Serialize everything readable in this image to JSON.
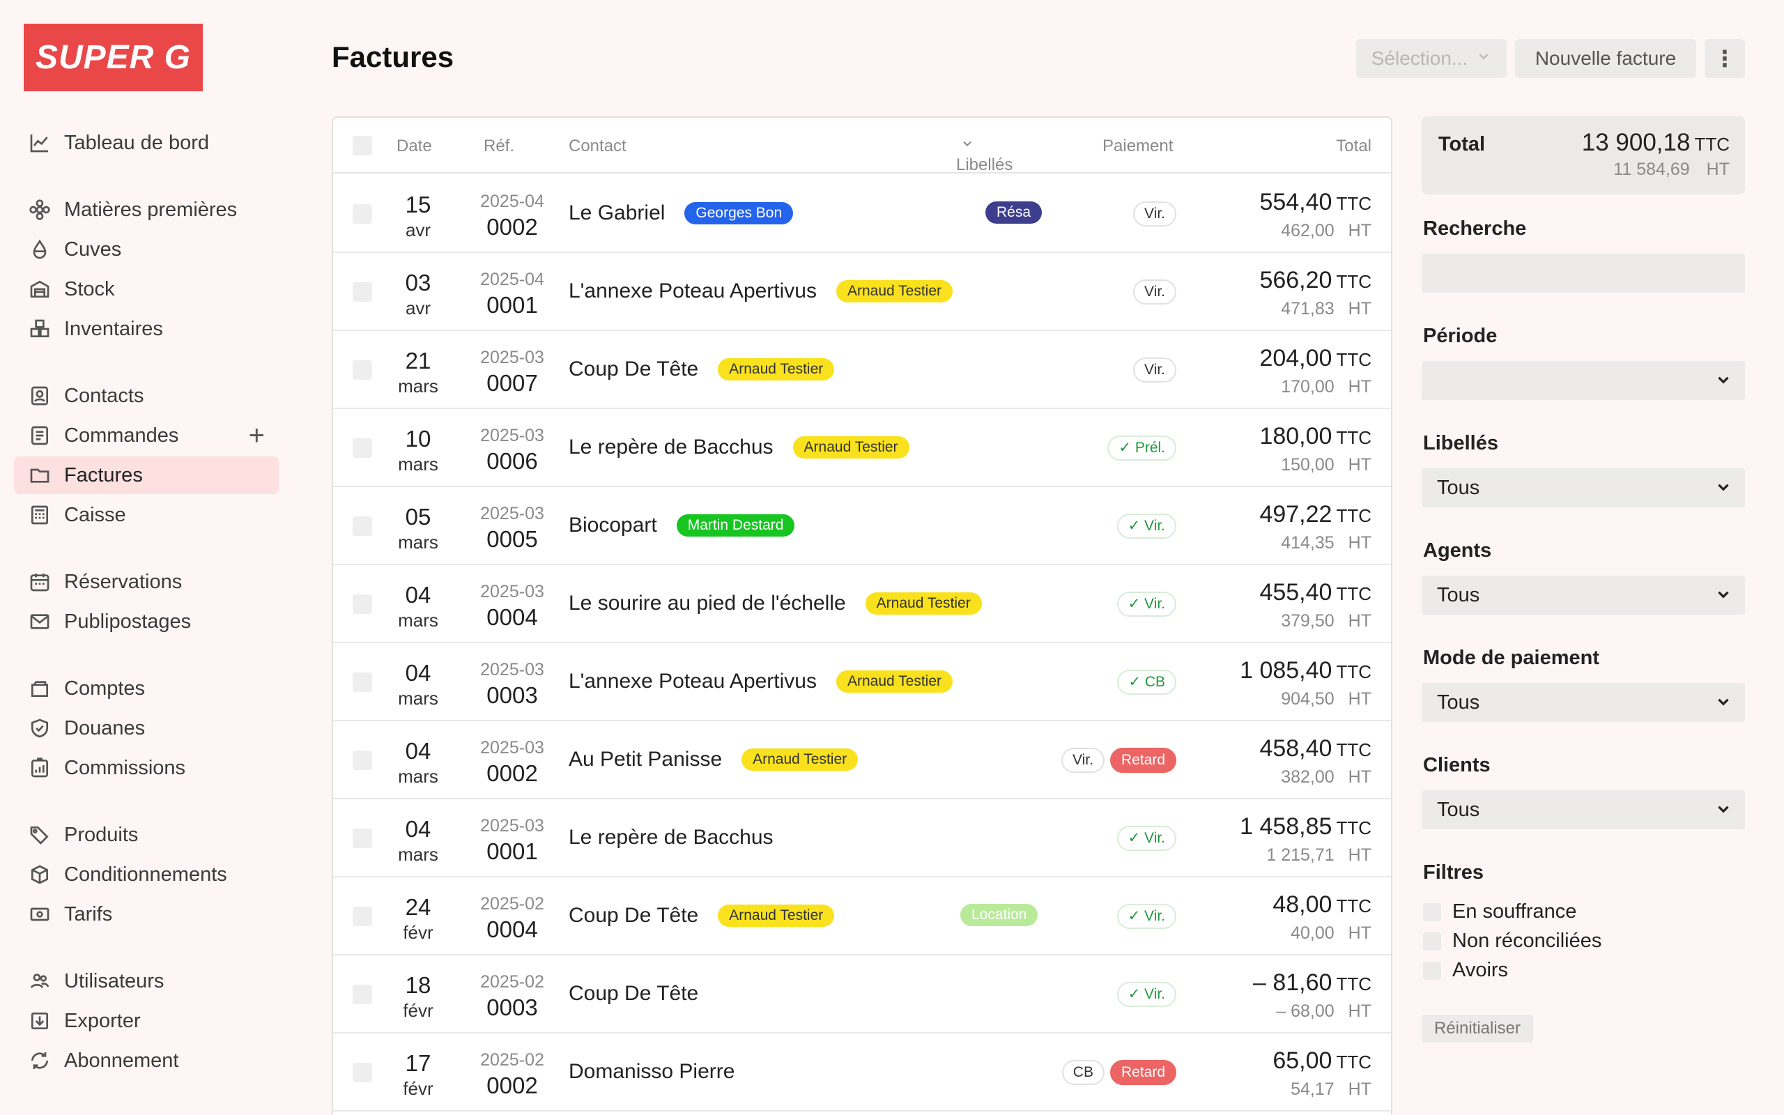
{
  "brand": {
    "logo_text": "SUPER G",
    "accent": "#ea4848"
  },
  "sidebar": {
    "items": [
      {
        "label": "Tableau de bord",
        "icon": "chart-line-icon"
      },
      {
        "label": "Matières premières",
        "icon": "flower-icon"
      },
      {
        "label": "Cuves",
        "icon": "droplet-icon"
      },
      {
        "label": "Stock",
        "icon": "warehouse-icon"
      },
      {
        "label": "Inventaires",
        "icon": "boxes-icon"
      },
      {
        "label": "Contacts",
        "icon": "contact-card-icon"
      },
      {
        "label": "Commandes",
        "icon": "order-list-icon"
      },
      {
        "label": "Factures",
        "icon": "folder-icon",
        "active": true
      },
      {
        "label": "Caisse",
        "icon": "register-icon"
      },
      {
        "label": "Réservations",
        "icon": "calendar-icon"
      },
      {
        "label": "Publipostages",
        "icon": "mail-icon"
      },
      {
        "label": "Comptes",
        "icon": "wallet-icon"
      },
      {
        "label": "Douanes",
        "icon": "shield-check-icon"
      },
      {
        "label": "Commissions",
        "icon": "commission-icon"
      },
      {
        "label": "Produits",
        "icon": "tags-icon"
      },
      {
        "label": "Conditionnements",
        "icon": "package-icon"
      },
      {
        "label": "Tarifs",
        "icon": "banknote-icon"
      },
      {
        "label": "Utilisateurs",
        "icon": "users-icon"
      },
      {
        "label": "Exporter",
        "icon": "export-icon"
      },
      {
        "label": "Abonnement",
        "icon": "refresh-icon"
      }
    ],
    "commandes_add": "+"
  },
  "header": {
    "title": "Factures",
    "selection_label": "Sélection...",
    "new_invoice_label": "Nouvelle facture",
    "more_label": "⋮"
  },
  "table": {
    "columns": {
      "date": "Date",
      "ref": "Réf.",
      "contact": "Contact",
      "labels": "Libellés",
      "payment": "Paiement",
      "total": "Total"
    },
    "ttc_unit": "TTC",
    "ht_unit": "HT",
    "rows": [
      {
        "day": "15",
        "month": "avr",
        "ref_year": "2025-04",
        "ref_num": "0002",
        "contact": "Le Gabriel",
        "agent": "Georges Bon",
        "agent_color": "blue",
        "label": "Résa",
        "label_style": "resa",
        "payment": [
          {
            "text": "Vir.",
            "style": "plain"
          }
        ],
        "ttc": "554,40",
        "ht": "462,00"
      },
      {
        "day": "03",
        "month": "avr",
        "ref_year": "2025-04",
        "ref_num": "0001",
        "contact": "L'annexe Poteau Apertivus",
        "agent": "Arnaud Testier",
        "agent_color": "yellow",
        "label": "",
        "label_style": "",
        "payment": [
          {
            "text": "Vir.",
            "style": "plain"
          }
        ],
        "ttc": "566,20",
        "ht": "471,83"
      },
      {
        "day": "21",
        "month": "mars",
        "ref_year": "2025-03",
        "ref_num": "0007",
        "contact": "Coup De Tête",
        "agent": "Arnaud Testier",
        "agent_color": "yellow",
        "label": "",
        "label_style": "",
        "payment": [
          {
            "text": "Vir.",
            "style": "plain"
          }
        ],
        "ttc": "204,00",
        "ht": "170,00"
      },
      {
        "day": "10",
        "month": "mars",
        "ref_year": "2025-03",
        "ref_num": "0006",
        "contact": "Le repère de Bacchus",
        "agent": "Arnaud Testier",
        "agent_color": "yellow",
        "label": "",
        "label_style": "",
        "payment": [
          {
            "text": "✓ Prél.",
            "style": "ok"
          }
        ],
        "ttc": "180,00",
        "ht": "150,00"
      },
      {
        "day": "05",
        "month": "mars",
        "ref_year": "2025-03",
        "ref_num": "0005",
        "contact": "Biocopart",
        "agent": "Martin Destard",
        "agent_color": "green",
        "label": "",
        "label_style": "",
        "payment": [
          {
            "text": "✓ Vir.",
            "style": "ok"
          }
        ],
        "ttc": "497,22",
        "ht": "414,35"
      },
      {
        "day": "04",
        "month": "mars",
        "ref_year": "2025-03",
        "ref_num": "0004",
        "contact": "Le sourire au pied de l'échelle",
        "agent": "Arnaud Testier",
        "agent_color": "yellow",
        "label": "",
        "label_style": "",
        "payment": [
          {
            "text": "✓ Vir.",
            "style": "ok"
          }
        ],
        "ttc": "455,40",
        "ht": "379,50"
      },
      {
        "day": "04",
        "month": "mars",
        "ref_year": "2025-03",
        "ref_num": "0003",
        "contact": "L'annexe Poteau Apertivus",
        "agent": "Arnaud Testier",
        "agent_color": "yellow",
        "label": "",
        "label_style": "",
        "payment": [
          {
            "text": "✓ CB",
            "style": "ok"
          }
        ],
        "ttc": "1 085,40",
        "ht": "904,50"
      },
      {
        "day": "04",
        "month": "mars",
        "ref_year": "2025-03",
        "ref_num": "0002",
        "contact": "Au Petit Panisse",
        "agent": "Arnaud Testier",
        "agent_color": "yellow",
        "label": "",
        "label_style": "",
        "payment": [
          {
            "text": "Vir.",
            "style": "plain"
          },
          {
            "text": "Retard",
            "style": "late"
          }
        ],
        "ttc": "458,40",
        "ht": "382,00"
      },
      {
        "day": "04",
        "month": "mars",
        "ref_year": "2025-03",
        "ref_num": "0001",
        "contact": "Le repère de Bacchus",
        "agent": "",
        "agent_color": "",
        "label": "",
        "label_style": "",
        "payment": [
          {
            "text": "✓ Vir.",
            "style": "ok"
          }
        ],
        "ttc": "1 458,85",
        "ht": "1 215,71"
      },
      {
        "day": "24",
        "month": "févr",
        "ref_year": "2025-02",
        "ref_num": "0004",
        "contact": "Coup De Tête",
        "agent": "Arnaud Testier",
        "agent_color": "yellow",
        "label": "Location",
        "label_style": "loc",
        "payment": [
          {
            "text": "✓ Vir.",
            "style": "ok"
          }
        ],
        "ttc": "48,00",
        "ht": "40,00"
      },
      {
        "day": "18",
        "month": "févr",
        "ref_year": "2025-02",
        "ref_num": "0003",
        "contact": "Coup De Tête",
        "agent": "",
        "agent_color": "",
        "label": "",
        "label_style": "",
        "payment": [
          {
            "text": "✓ Vir.",
            "style": "ok"
          }
        ],
        "ttc": "– 81,60",
        "ht": "– 68,00"
      },
      {
        "day": "17",
        "month": "févr",
        "ref_year": "2025-02",
        "ref_num": "0002",
        "contact": "Domanisso Pierre",
        "agent": "",
        "agent_color": "",
        "label": "",
        "label_style": "",
        "payment": [
          {
            "text": "CB",
            "style": "plain"
          },
          {
            "text": "Retard",
            "style": "late"
          }
        ],
        "ttc": "65,00",
        "ht": "54,17"
      }
    ]
  },
  "panel": {
    "total_label": "Total",
    "total_ttc": "13 900,18",
    "total_ht": "11 584,69",
    "search_label": "Recherche",
    "search_value": "",
    "period_label": "Période",
    "period_value": "",
    "labels_label": "Libellés",
    "labels_value": "Tous",
    "agents_label": "Agents",
    "agents_value": "Tous",
    "payment_mode_label": "Mode de paiement",
    "payment_mode_value": "Tous",
    "clients_label": "Clients",
    "clients_value": "Tous",
    "filters_label": "Filtres",
    "filters": [
      "En souffrance",
      "Non réconciliées",
      "Avoirs"
    ],
    "reset_label": "Réinitialiser"
  }
}
